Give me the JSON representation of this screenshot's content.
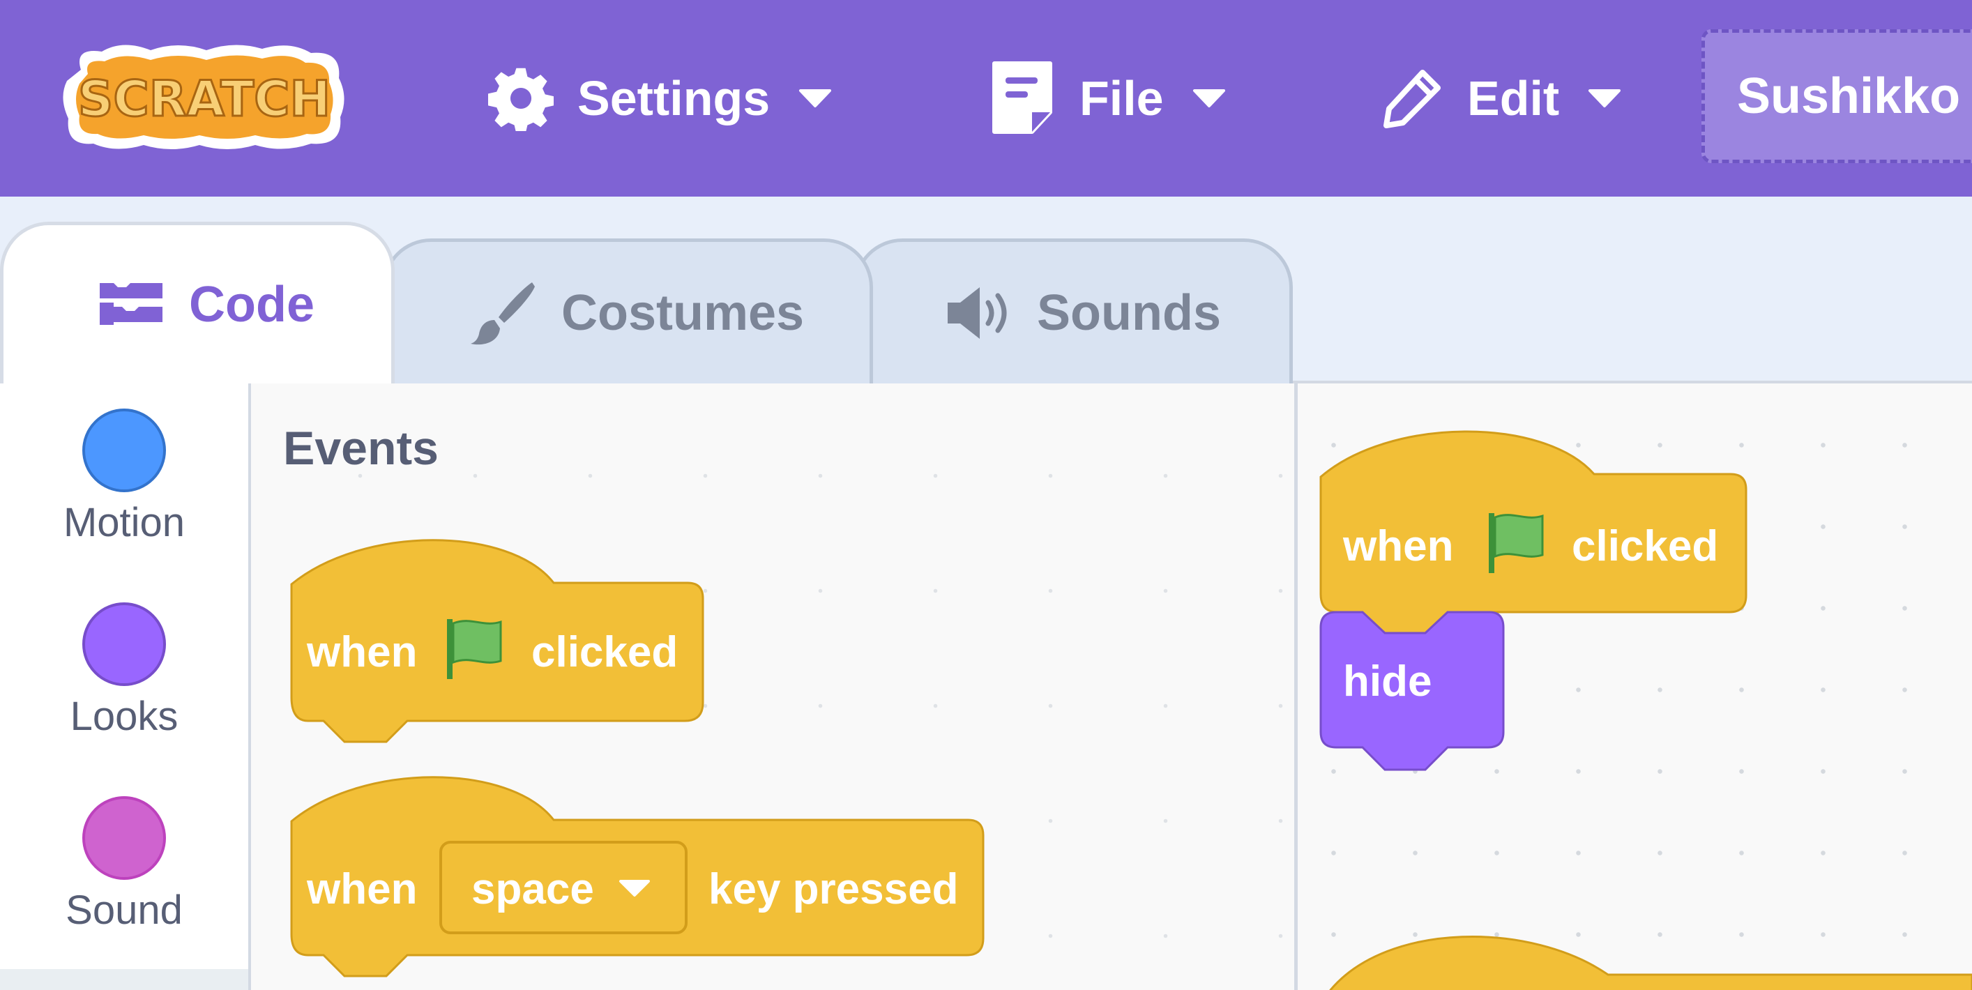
{
  "menubar": {
    "logo_text": "SCRATCH",
    "settings_label": "Settings",
    "file_label": "File",
    "edit_label": "Edit",
    "project_title": "Sushikko"
  },
  "tabs": [
    {
      "label": "Code",
      "icon": "code-icon",
      "active": true
    },
    {
      "label": "Costumes",
      "icon": "paintbrush-icon",
      "active": false
    },
    {
      "label": "Sounds",
      "icon": "speaker-icon",
      "active": false
    }
  ],
  "categories": [
    {
      "label": "Motion",
      "color": "#4c97ff"
    },
    {
      "label": "Looks",
      "color": "#9966ff"
    },
    {
      "label": "Sound",
      "color": "#cf63cf"
    }
  ],
  "flyout": {
    "heading": "Events",
    "blocks": [
      {
        "parts": [
          "when",
          "flag-icon",
          "clicked"
        ]
      },
      {
        "parts": [
          "when",
          "space",
          "key pressed"
        ],
        "dropdown_value": "space"
      }
    ]
  },
  "script": {
    "blocks": [
      {
        "parts": [
          "when",
          "flag-icon",
          "clicked"
        ]
      },
      {
        "parts": [
          "hide"
        ]
      }
    ]
  },
  "colors": {
    "menubar": "#7f63d4",
    "events_block": "#ffbf00",
    "looks_block": "#9966ff",
    "flag": "#4cbf56"
  }
}
